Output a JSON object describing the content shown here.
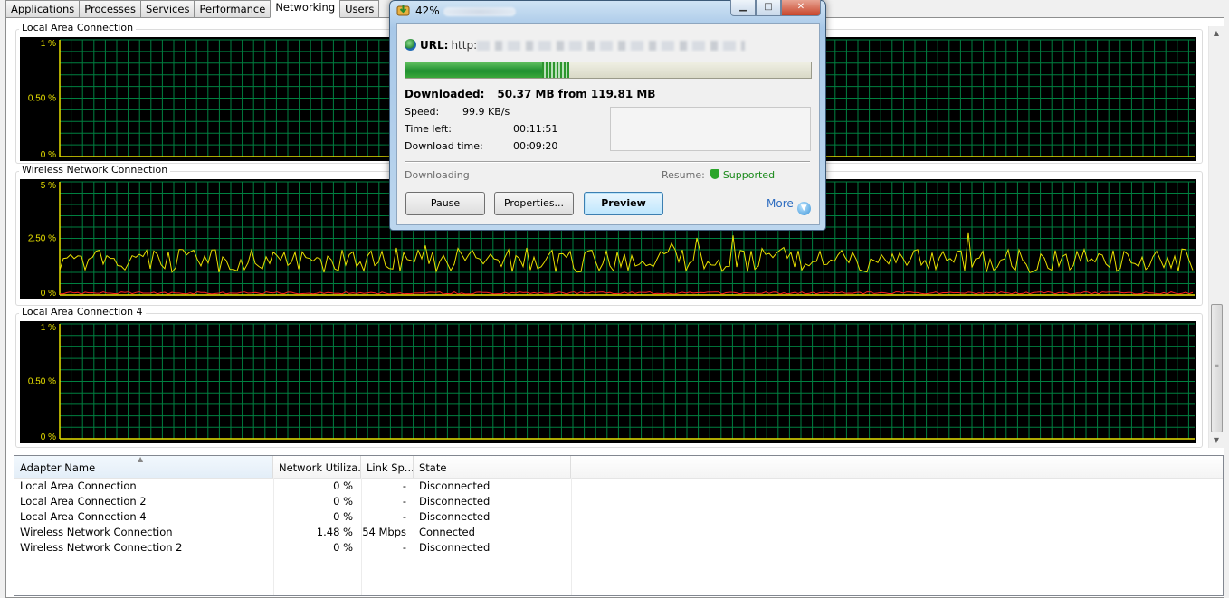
{
  "tabs": [
    "Applications",
    "Processes",
    "Services",
    "Performance",
    "Networking",
    "Users"
  ],
  "active_tab": "Networking",
  "graphs": [
    {
      "title": "Local Area Connection",
      "y_labels": [
        "1 %",
        "0.50 %",
        "0 %"
      ]
    },
    {
      "title": "Wireless Network Connection",
      "y_labels": [
        "5 %",
        "2.50 %",
        "0 %"
      ]
    },
    {
      "title": "Local Area Connection 4",
      "y_labels": [
        "1 %",
        "0.50 %",
        "0 %"
      ]
    }
  ],
  "colors": {
    "graph_bg": "#000000",
    "grid": "#008040",
    "axis": "#e8e000",
    "sent_line": "#e8e000",
    "recv_line": "#ff2020",
    "progress": "#1f8f2f"
  },
  "table": {
    "columns": [
      "Adapter Name",
      "Network Utiliza...",
      "Link Sp...",
      "State"
    ],
    "rows": [
      {
        "name": "Local Area Connection",
        "util": "0 %",
        "link": "-",
        "state": "Disconnected"
      },
      {
        "name": "Local Area Connection 2",
        "util": "0 %",
        "link": "-",
        "state": "Disconnected"
      },
      {
        "name": "Local Area Connection 4",
        "util": "0 %",
        "link": "-",
        "state": "Disconnected"
      },
      {
        "name": "Wireless Network Connection",
        "util": "1.48 %",
        "link": "54 Mbps",
        "state": "Connected"
      },
      {
        "name": "Wireless Network Connection 2",
        "util": "0 %",
        "link": "-",
        "state": "Disconnected"
      }
    ]
  },
  "download": {
    "title_percent": "42%",
    "url_label": "URL:",
    "url_prefix": "http:",
    "progress_percent": 42,
    "downloaded_label": "Downloaded:",
    "downloaded_value": "50.37 MB from 119.81 MB",
    "speed_label": "Speed:",
    "speed_value": "99.9 KB/s",
    "time_left_label": "Time left:",
    "time_left_value": "00:11:51",
    "download_time_label": "Download time:",
    "download_time_value": "00:09:20",
    "status": "Downloading",
    "resume_label": "Resume:",
    "resume_value": "Supported",
    "buttons": {
      "pause": "Pause",
      "properties": "Properties...",
      "preview": "Preview",
      "more": "More"
    }
  }
}
